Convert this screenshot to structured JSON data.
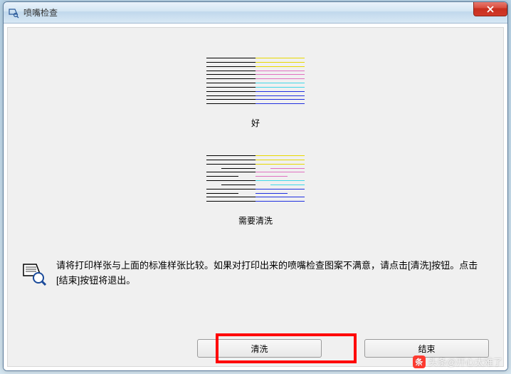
{
  "window": {
    "title": "喷嘴检查"
  },
  "samples": {
    "good_label": "好",
    "bad_label": "需要清洗"
  },
  "instruction": {
    "text": "请将打印样张与上面的标准样张比较。如果对打印出来的喷嘴检查图案不满意，请点击[清洗]按钮。点击[结束]按钮将退出。"
  },
  "buttons": {
    "clean": "清洗",
    "finish": "结束"
  },
  "watermark": {
    "text": "头条@开心太难了"
  }
}
